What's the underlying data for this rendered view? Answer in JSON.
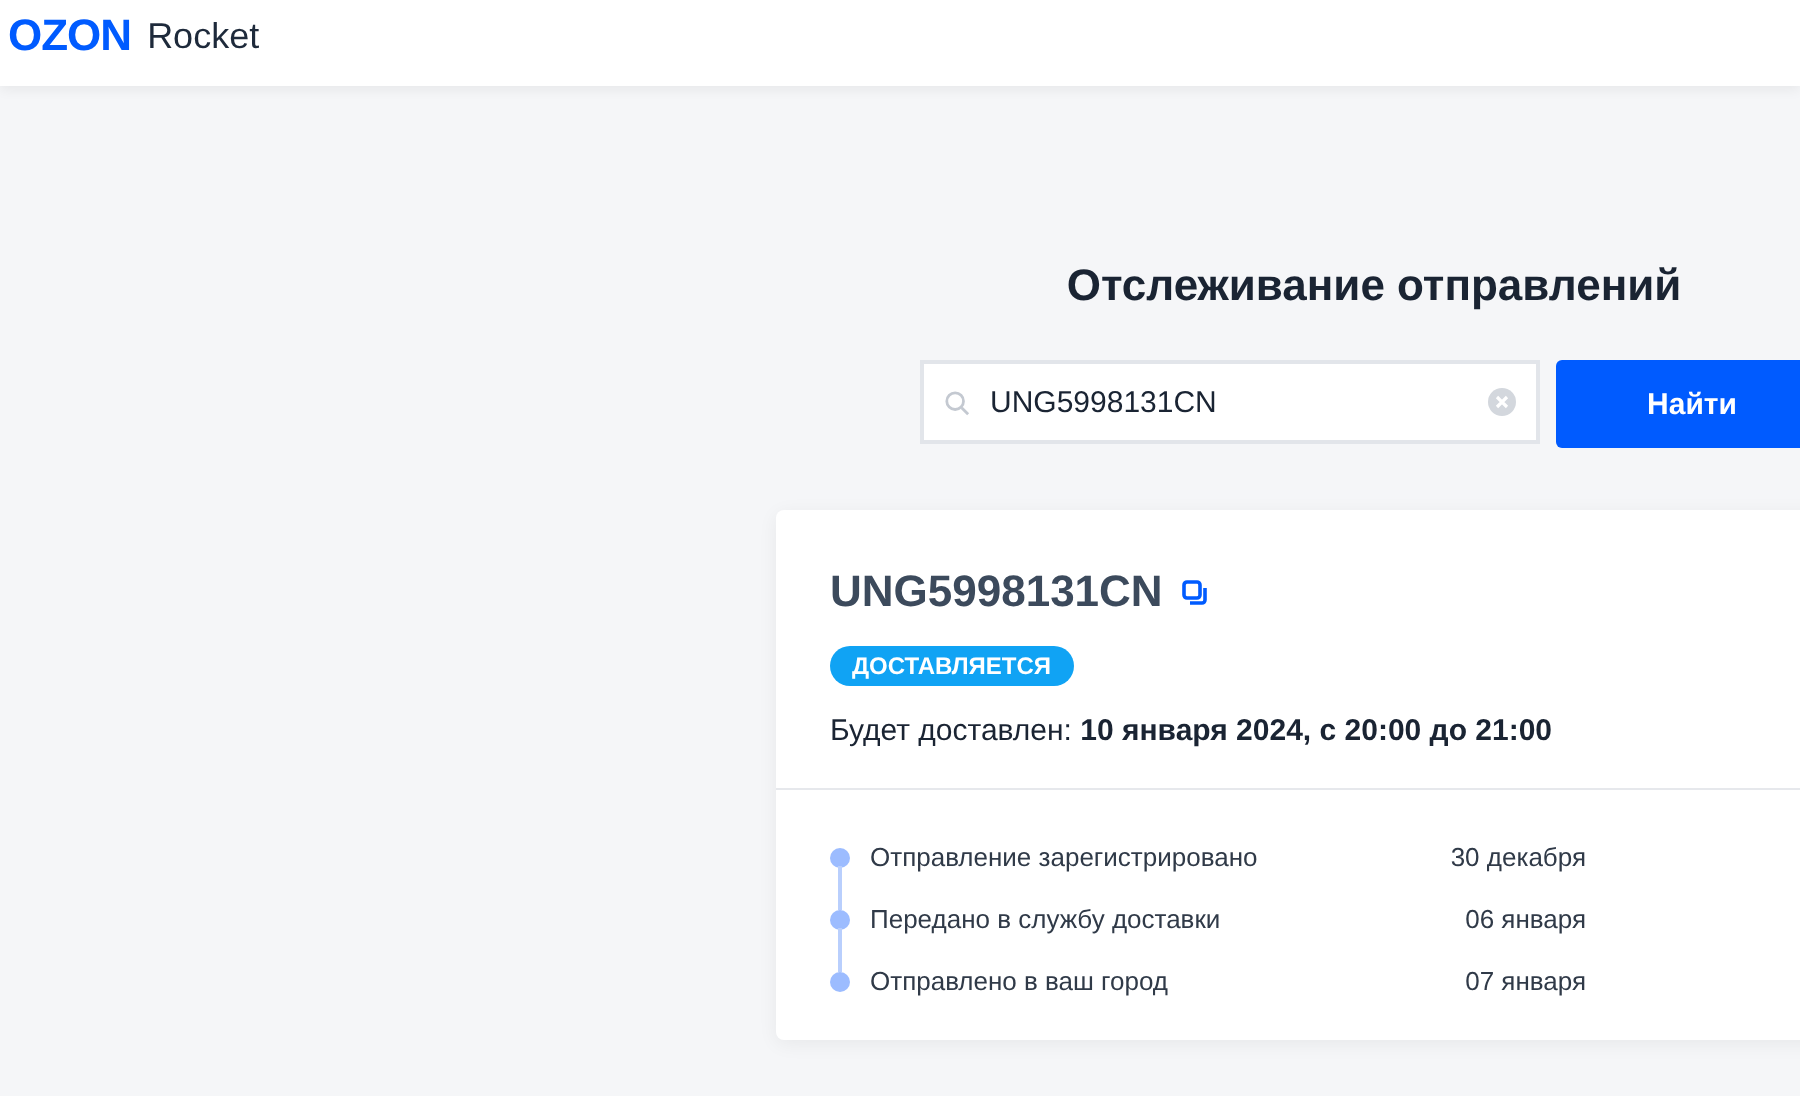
{
  "header": {
    "logo": "OZON",
    "product": "Rocket"
  },
  "title": "Отслеживание отправлений",
  "search": {
    "value": "UNG5998131CN",
    "button": "Найти"
  },
  "shipment": {
    "number": "UNG5998131CN",
    "status": "ДОСТАВЛЯЕТСЯ",
    "eta": "Будет доставлен: **10 января 2024, с 20:00 до 21:00**",
    "events": [
      {
        "label": "Отправление зарегистрировано",
        "date": "30 декабря"
      },
      {
        "label": "Передано в службу доставки",
        "date": "06 января"
      },
      {
        "label": "Отправлено в ваш город",
        "date": "07 января"
      }
    ]
  }
}
